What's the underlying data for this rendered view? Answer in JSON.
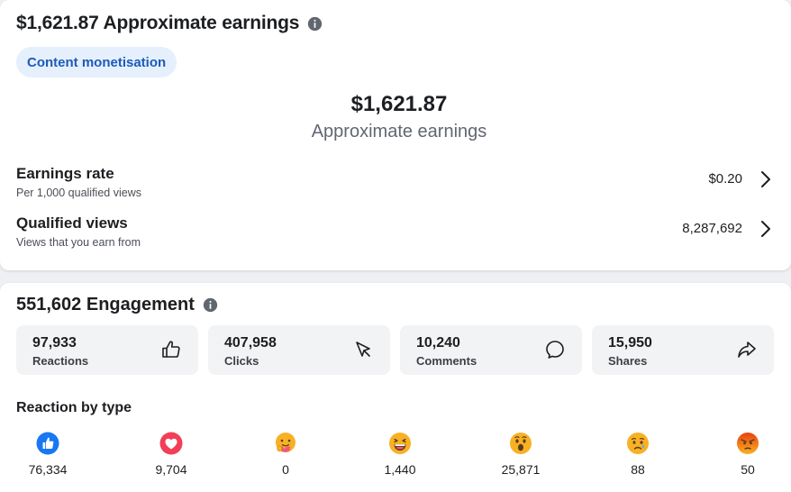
{
  "earnings": {
    "header_title": "$1,621.87 Approximate earnings",
    "pill_label": "Content monetisation",
    "big_amount": "$1,621.87",
    "big_sub": "Approximate earnings",
    "rate": {
      "title": "Earnings rate",
      "desc": "Per 1,000 qualified views",
      "value": "$0.20"
    },
    "views": {
      "title": "Qualified views",
      "desc": "Views that you earn from",
      "value": "8,287,692"
    }
  },
  "engagement": {
    "header_title": "551,602 Engagement",
    "stats": [
      {
        "value": "97,933",
        "label": "Reactions",
        "icon": "thumbs-up-outline-icon"
      },
      {
        "value": "407,958",
        "label": "Clicks",
        "icon": "cursor-click-icon"
      },
      {
        "value": "10,240",
        "label": "Comments",
        "icon": "comment-bubble-icon"
      },
      {
        "value": "15,950",
        "label": "Shares",
        "icon": "share-arrow-icon"
      }
    ],
    "reaction_title": "Reaction by type",
    "reactions": [
      {
        "type": "like",
        "count": "76,334"
      },
      {
        "type": "love",
        "count": "9,704"
      },
      {
        "type": "care",
        "count": "0"
      },
      {
        "type": "haha",
        "count": "1,440"
      },
      {
        "type": "wow",
        "count": "25,871"
      },
      {
        "type": "sad",
        "count": "88"
      },
      {
        "type": "angry",
        "count": "50"
      }
    ]
  },
  "colors": {
    "accent_blue": "#1877f2",
    "pill_bg": "#e6f0fd",
    "pill_text": "#1b5bb8",
    "love_red": "#f33e58",
    "emoji_yellow": "#f7b125",
    "angry_red": "#e9710f"
  }
}
